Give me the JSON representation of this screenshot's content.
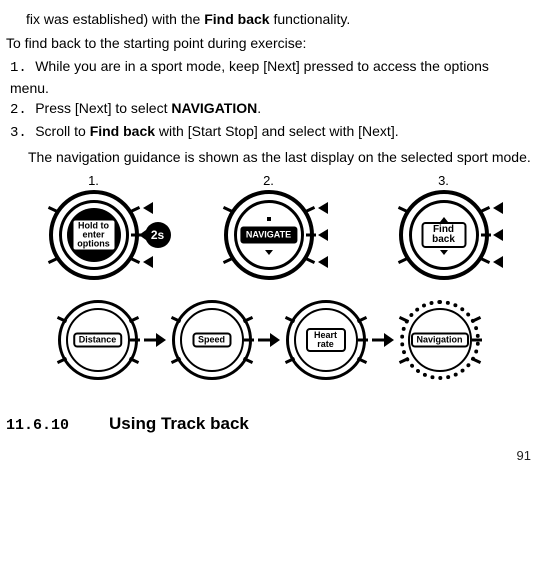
{
  "fragment_top": "fix was established) with the ",
  "fragment_bold": "Find back",
  "fragment_end": " functionality.",
  "intro": "To find back to the starting point during exercise:",
  "steps": {
    "s1a": "While you are in a sport mode, keep [Next] pressed to access the options menu.",
    "s2a": "Press [Next] to select ",
    "s2b": "NAVIGATION",
    "s2c": ".",
    "s3a": "Scroll to ",
    "s3b": "Find back",
    "s3c": " with [Start Stop] and select with [Next]."
  },
  "after": "The navigation guidance is shown as the last display on the selected sport mode.",
  "fig": {
    "n1": "1.",
    "n2": "2.",
    "n3": "3.",
    "hold_label": "Hold to enter options",
    "two_s": "2s",
    "navigate": "NAVIGATE",
    "findback": "Find back",
    "distance": "Distance",
    "speed": "Speed",
    "heartrate": "Heart rate",
    "navigation": "Navigation"
  },
  "section": {
    "num": "11.6.10",
    "title": "Using Track back"
  },
  "page": "91"
}
